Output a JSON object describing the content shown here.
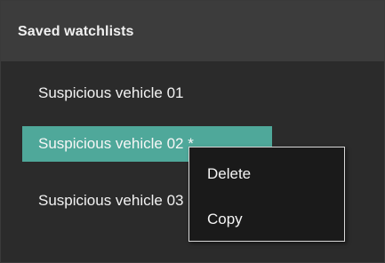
{
  "panel": {
    "title": "Saved watchlists"
  },
  "watchlists": {
    "items": [
      {
        "label": "Suspicious vehicle 01",
        "selected": false
      },
      {
        "label": "Suspicious vehicle 02 *",
        "selected": true
      },
      {
        "label": "Suspicious vehicle 03",
        "selected": false
      }
    ]
  },
  "context_menu": {
    "items": [
      {
        "label": "Delete"
      },
      {
        "label": "Copy"
      }
    ]
  },
  "colors": {
    "selection": "#4fa89a",
    "header_bg": "#3c3c3c",
    "panel_bg": "#2b2b2b",
    "menu_bg": "#1a1a1a",
    "menu_border": "#d8d8d8"
  }
}
